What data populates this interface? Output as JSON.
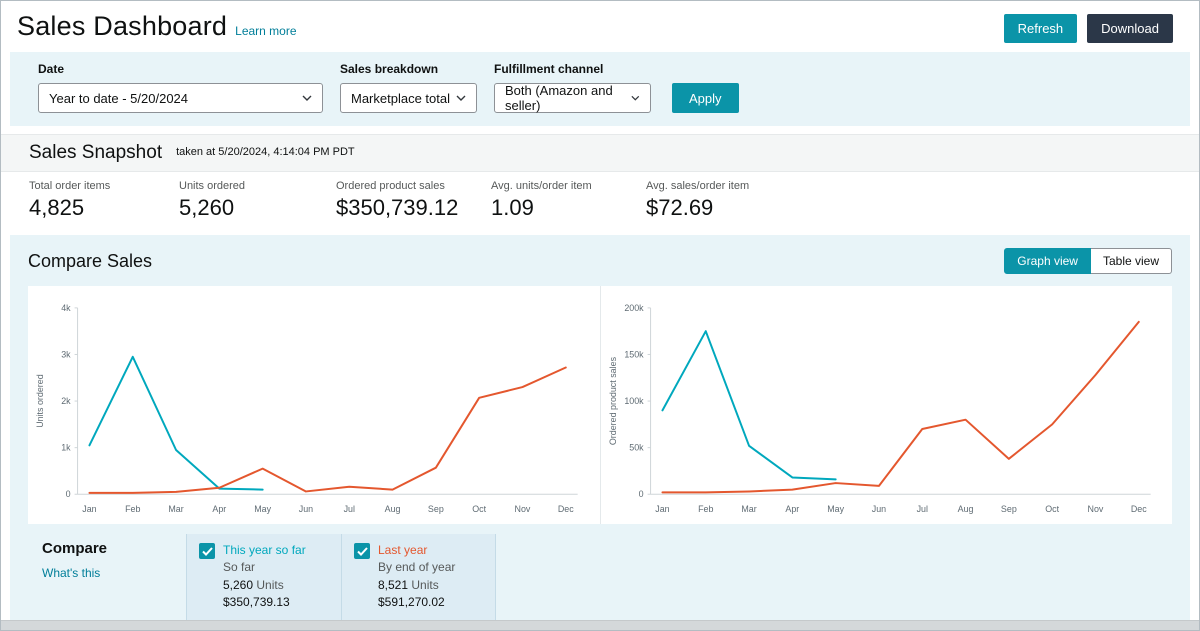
{
  "header": {
    "title": "Sales Dashboard",
    "learn_more_label": "Learn more",
    "refresh_label": "Refresh",
    "download_label": "Download"
  },
  "filters": {
    "date_label": "Date",
    "date_value": "Year to date - 5/20/2024",
    "breakdown_label": "Sales breakdown",
    "breakdown_value": "Marketplace total",
    "channel_label": "Fulfillment channel",
    "channel_value": "Both (Amazon and seller)",
    "apply_label": "Apply"
  },
  "snapshot": {
    "title": "Sales Snapshot",
    "taken_at": "taken at 5/20/2024, 4:14:04 PM PDT",
    "stats": [
      {
        "label": "Total order items",
        "value": "4,825"
      },
      {
        "label": "Units ordered",
        "value": "5,260"
      },
      {
        "label": "Ordered product sales",
        "value": "$350,739.12"
      },
      {
        "label": "Avg. units/order item",
        "value": "1.09"
      },
      {
        "label": "Avg. sales/order item",
        "value": "$72.69"
      }
    ]
  },
  "compare": {
    "title": "Compare Sales",
    "graph_view_label": "Graph view",
    "table_view_label": "Table view",
    "legend_title": "Compare",
    "whats_this_label": "What's this",
    "items": [
      {
        "label": "This year so far",
        "sublabel": "So far",
        "units": "5,260",
        "units_word": "Units",
        "sales": "$350,739.13",
        "color": "#00a8bd"
      },
      {
        "label": "Last year",
        "sublabel": "By end of year",
        "units": "8,521",
        "units_word": "Units",
        "sales": "$591,270.02",
        "color": "#e4572e"
      }
    ]
  },
  "colors": {
    "accent_teal": "#0b94a8",
    "link_teal": "#007e99",
    "dark_button": "#2b3748",
    "this_year_line": "#00a8bd",
    "last_year_line": "#e4572e",
    "section_background": "#e8f4f8"
  },
  "chart_data": [
    {
      "type": "line",
      "ylabel": "Units ordered",
      "x": [
        "Jan",
        "Feb",
        "Mar",
        "Apr",
        "May",
        "Jun",
        "Jul",
        "Aug",
        "Sep",
        "Oct",
        "Nov",
        "Dec"
      ],
      "ylim": [
        0,
        4000
      ],
      "yticks": [
        "0",
        "1k",
        "2k",
        "3k",
        "4k"
      ],
      "grid": false,
      "legend_position": "bottom",
      "series": [
        {
          "name": "This year so far",
          "color": "#00a8bd",
          "values": [
            1050,
            2950,
            950,
            120,
            100
          ]
        },
        {
          "name": "Last year",
          "color": "#e4572e",
          "values": [
            30,
            30,
            50,
            140,
            550,
            60,
            160,
            100,
            570,
            2070,
            2300,
            2720
          ]
        }
      ]
    },
    {
      "type": "line",
      "ylabel": "Ordered product sales",
      "x": [
        "Jan",
        "Feb",
        "Mar",
        "Apr",
        "May",
        "Jun",
        "Jul",
        "Aug",
        "Sep",
        "Oct",
        "Nov",
        "Dec"
      ],
      "ylim": [
        0,
        200000
      ],
      "yticks": [
        "0",
        "50k",
        "100k",
        "150k",
        "200k"
      ],
      "grid": false,
      "legend_position": "bottom",
      "series": [
        {
          "name": "This year so far",
          "color": "#00a8bd",
          "values": [
            90000,
            175000,
            52000,
            18000,
            16000
          ]
        },
        {
          "name": "Last year",
          "color": "#e4572e",
          "values": [
            2000,
            2000,
            3000,
            5000,
            12000,
            9000,
            70000,
            80000,
            38000,
            75000,
            128000,
            185000
          ]
        }
      ]
    }
  ]
}
